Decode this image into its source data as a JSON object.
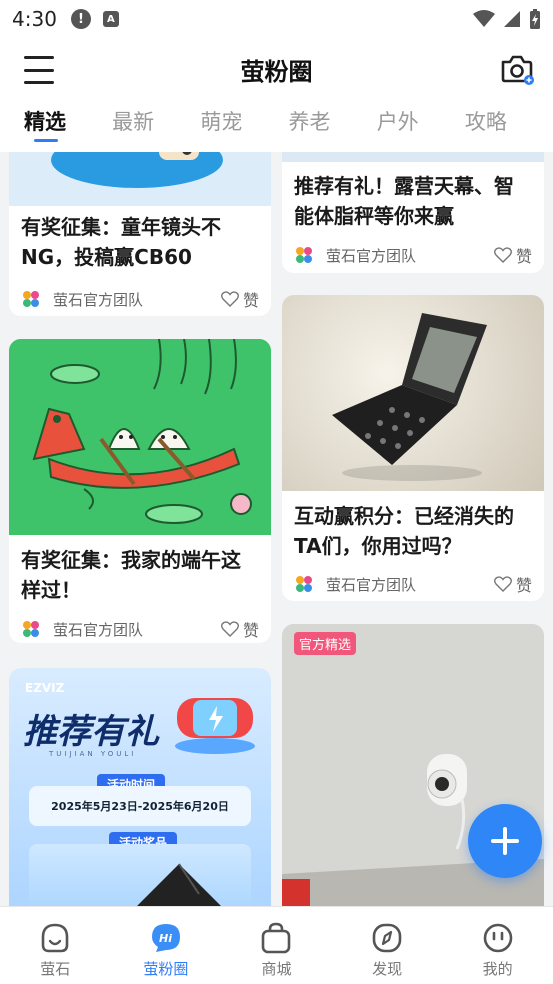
{
  "status_bar": {
    "time": "4:30"
  },
  "header": {
    "title": "萤粉圈"
  },
  "tabs": [
    {
      "label": "精选",
      "active": true
    },
    {
      "label": "最新",
      "active": false
    },
    {
      "label": "萌宠",
      "active": false
    },
    {
      "label": "养老",
      "active": false
    },
    {
      "label": "户外",
      "active": false
    },
    {
      "label": "攻略",
      "active": false
    }
  ],
  "feed": {
    "left": [
      {
        "title": "有奖征集：童年镜头不NG，投稿赢CB60",
        "author": "萤石官方团队",
        "like_label": "赞"
      },
      {
        "title": "有奖征集：我家的端午这样过！",
        "author": "萤石官方团队",
        "like_label": "赞"
      },
      {
        "image_brand": "EZVIZ",
        "image_title": "推荐有礼",
        "image_subtitle": "TUIJIAN YOULI",
        "image_event_time_label": "活动时间",
        "image_dates": "2025年5月23日-2025年6月20日",
        "image_prize_label": "活动奖品"
      }
    ],
    "right": [
      {
        "title": "推荐有礼！露营天幕、智能体脂秤等你来赢",
        "author": "萤石官方团队",
        "like_label": "赞"
      },
      {
        "title": "互动赢积分：已经消失的TA们，你用过吗？",
        "author": "萤石官方团队",
        "like_label": "赞"
      },
      {
        "badge": "官方精选"
      }
    ]
  },
  "bottom_nav": [
    {
      "label": "萤石",
      "icon": "face-icon",
      "active": false
    },
    {
      "label": "萤粉圈",
      "icon": "hi-bubble-icon",
      "active": true
    },
    {
      "label": "商城",
      "icon": "shopping-bag-icon",
      "active": false
    },
    {
      "label": "发现",
      "icon": "compass-icon",
      "active": false
    },
    {
      "label": "我的",
      "icon": "profile-face-icon",
      "active": false
    }
  ],
  "colors": {
    "accent": "#2f7df6",
    "badge": "#f0577a",
    "fab": "#2f86f6"
  }
}
